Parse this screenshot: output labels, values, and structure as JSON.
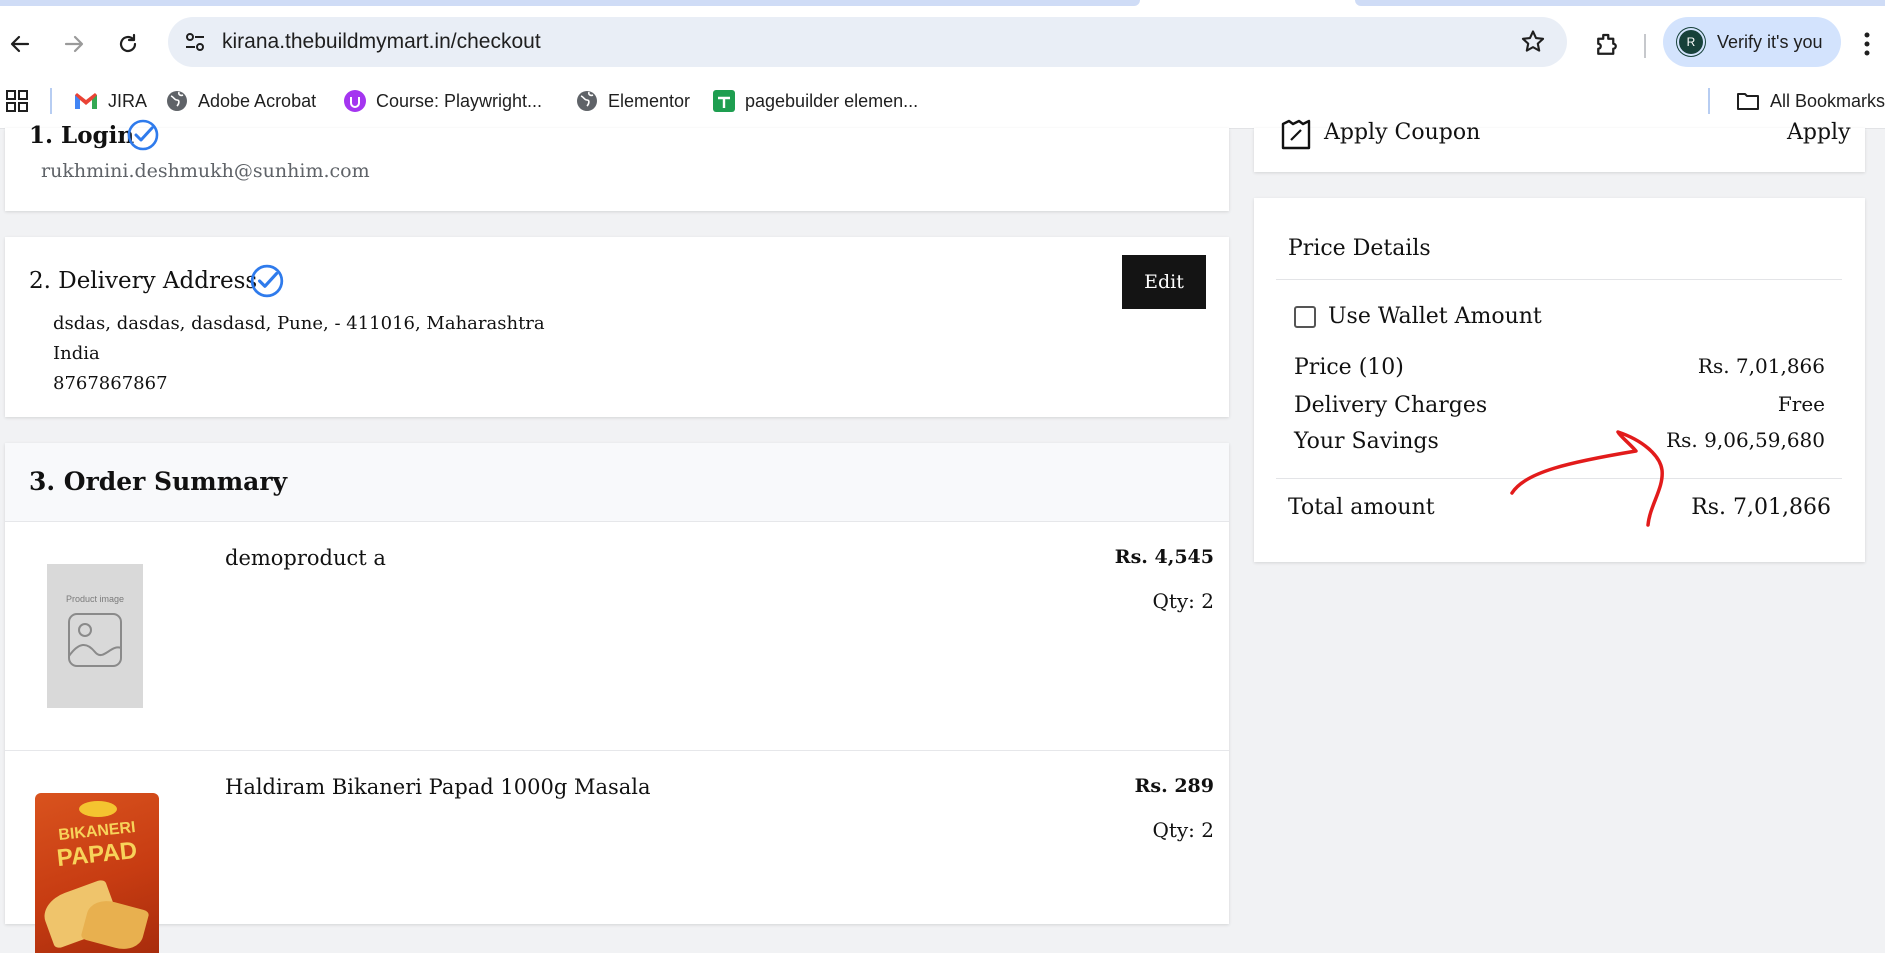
{
  "browser": {
    "url": "kirana.thebuildmymart.in/checkout",
    "profile_initial": "R",
    "profile_label": "Verify it's you",
    "bookmarks": [
      {
        "label": "JIRA"
      },
      {
        "label": "Adobe Acrobat"
      },
      {
        "label": "Course: Playwright..."
      },
      {
        "label": "Elementor"
      },
      {
        "label": "pagebuilder elemen..."
      }
    ],
    "all_bookmarks": "All Bookmarks"
  },
  "login": {
    "title": "1. Login",
    "email": "rukhmini.deshmukh@sunhim.com"
  },
  "delivery": {
    "title": "2. Delivery Address",
    "edit_label": "Edit",
    "lines": [
      "dsdas, dasdas, dasdasd, Pune, - 411016, Maharashtra",
      "India",
      "8767867867"
    ]
  },
  "order_summary": {
    "title": "3. Order Summary",
    "items": [
      {
        "name": "demoproduct a",
        "price": "Rs. 4,545",
        "qty": "Qty: 2",
        "image_text": "Product image"
      },
      {
        "name": "Haldiram Bikaneri Papad 1000g Masala",
        "price": "Rs. 289",
        "qty": "Qty: 2",
        "image_text_1": "BIKANERI",
        "image_text_2": "PAPAD"
      }
    ]
  },
  "coupon": {
    "label": "Apply Coupon",
    "apply": "Apply"
  },
  "price_details": {
    "title": "Price Details",
    "wallet_label": "Use Wallet Amount",
    "rows": [
      {
        "label": "Price (10)",
        "value": "Rs. 7,01,866"
      },
      {
        "label": "Delivery Charges",
        "value": "Free"
      },
      {
        "label": "Your Savings",
        "value": "Rs. 9,06,59,680"
      }
    ],
    "total_label": "Total amount",
    "total_value": "Rs. 7,01,866"
  },
  "colors": {
    "check_blue": "#2f7bec",
    "annotation_red": "#e21b1b",
    "edit_button_bg": "#141414"
  }
}
